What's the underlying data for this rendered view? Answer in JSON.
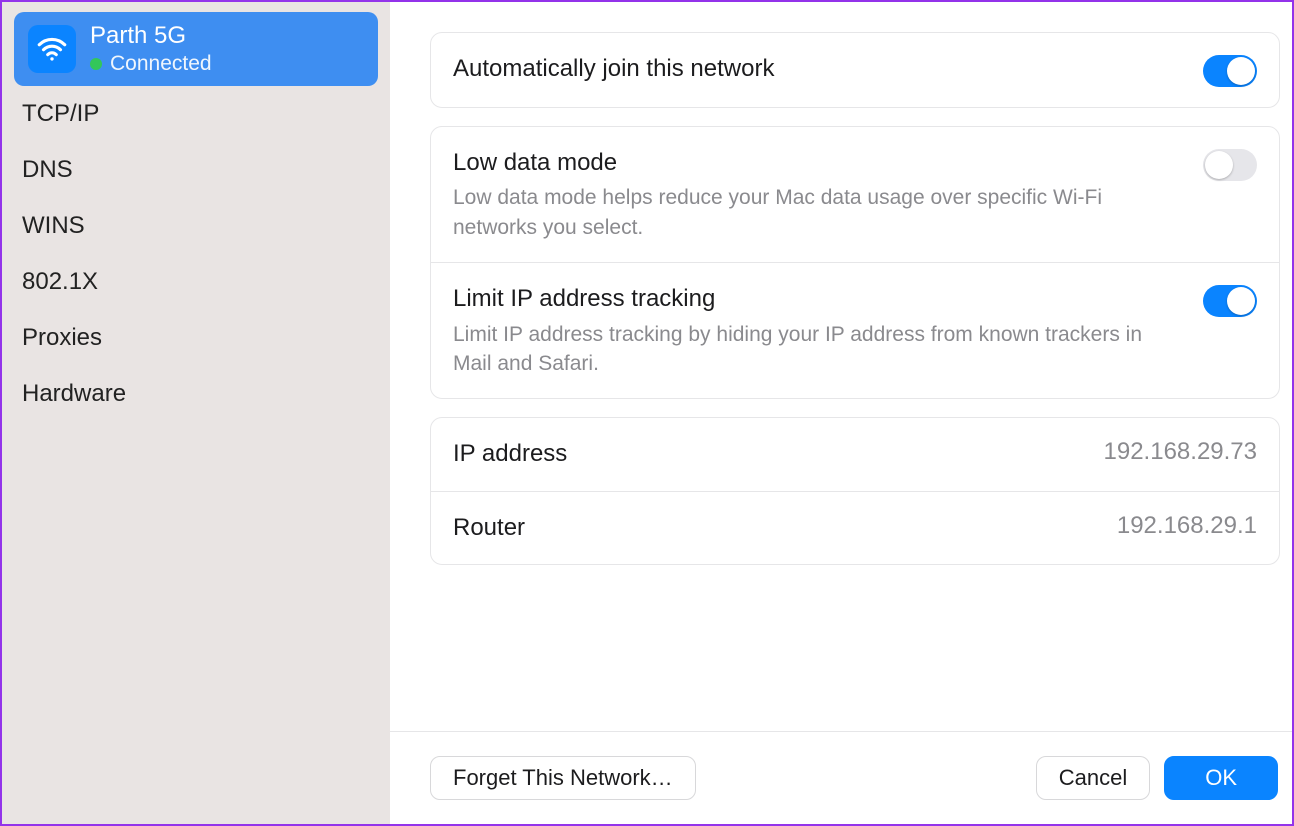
{
  "sidebar": {
    "network": {
      "name": "Parth 5G",
      "status": "Connected"
    },
    "items": [
      {
        "label": "TCP/IP"
      },
      {
        "label": "DNS"
      },
      {
        "label": "WINS"
      },
      {
        "label": "802.1X"
      },
      {
        "label": "Proxies"
      },
      {
        "label": "Hardware"
      }
    ]
  },
  "settings": {
    "auto_join": {
      "title": "Automatically join this network",
      "enabled": true
    },
    "low_data": {
      "title": "Low data mode",
      "desc": "Low data mode helps reduce your Mac data usage over specific Wi-Fi networks you select.",
      "enabled": false
    },
    "limit_ip": {
      "title": "Limit IP address tracking",
      "desc": "Limit IP address tracking by hiding your IP address from known trackers in Mail and Safari.",
      "enabled": true
    }
  },
  "info": {
    "ip_label": "IP address",
    "ip_value": "192.168.29.73",
    "router_label": "Router",
    "router_value": "192.168.29.1"
  },
  "footer": {
    "forget": "Forget This Network…",
    "cancel": "Cancel",
    "ok": "OK"
  },
  "colors": {
    "accent": "#0a84ff",
    "annotation": "#8b3dff"
  }
}
